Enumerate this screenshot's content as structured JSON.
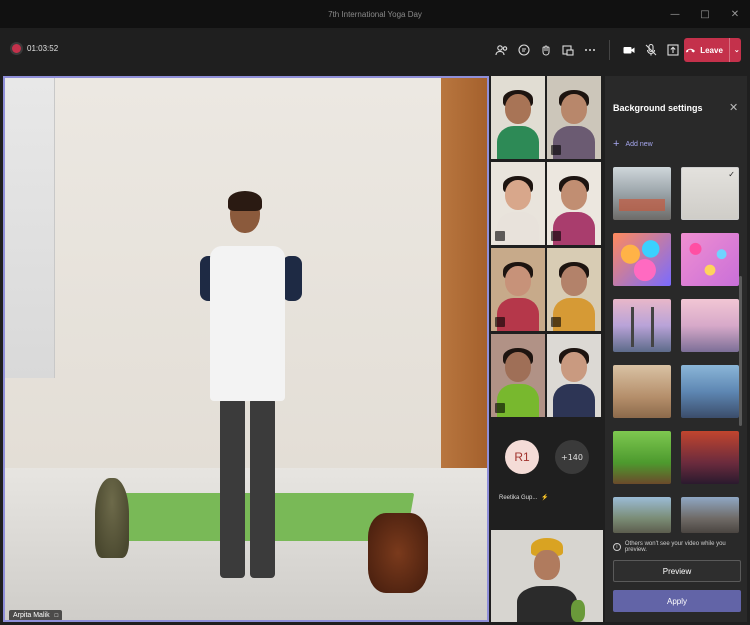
{
  "window": {
    "title": "7th International Yoga Day",
    "controls": [
      "minimize-icon",
      "maximize-icon",
      "close-icon"
    ]
  },
  "toolbar": {
    "recording_time": "01:03:52",
    "icons": [
      "participants-icon",
      "chat-icon",
      "reactions-icon",
      "rooms-icon",
      "more-icon",
      "camera-icon",
      "mic-off-icon",
      "share-icon"
    ],
    "leave_label": "Leave"
  },
  "main_video": {
    "participant_name": "Arpita Malik"
  },
  "gallery": {
    "avatar_initials": "R1",
    "more_count": "+140",
    "avatar_name": "Reetika Gup..."
  },
  "background_panel": {
    "title": "Background settings",
    "add_new_label": "Add new",
    "info_text": "Others won't see your video while you preview.",
    "preview_label": "Preview",
    "apply_label": "Apply",
    "selected_index": 1,
    "colors": {
      "accent": "#6264a7",
      "leave": "#c4314b",
      "link": "#a7a8f0"
    }
  }
}
